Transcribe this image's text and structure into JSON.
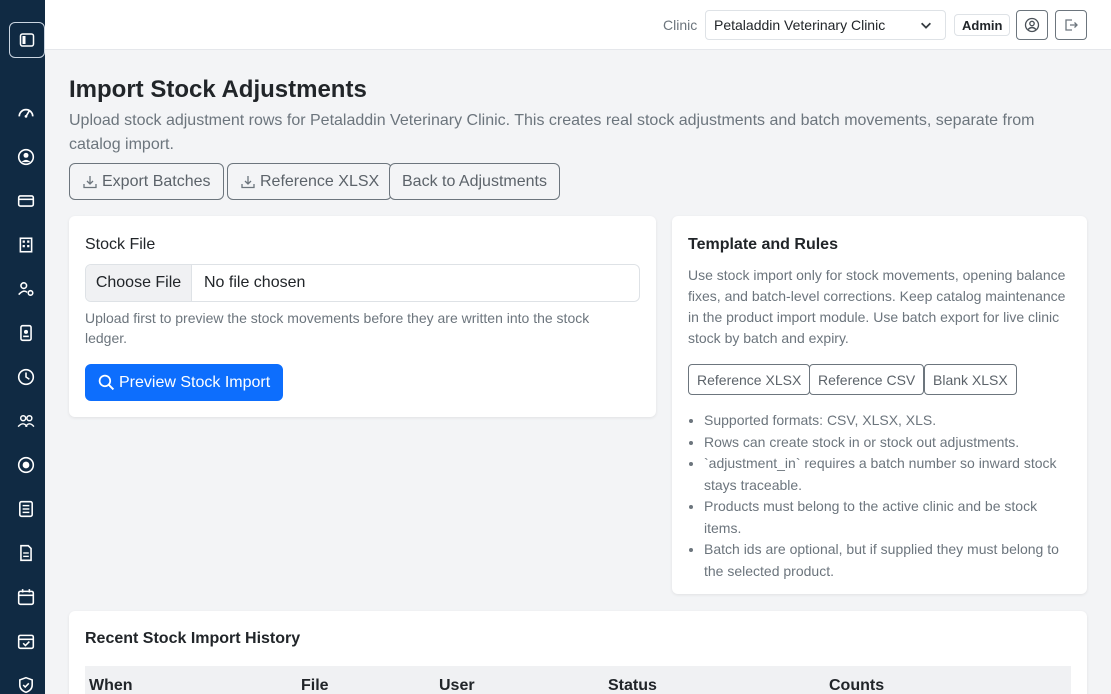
{
  "topbar": {
    "clinic_label": "Clinic",
    "clinic_selected": "Petaladdin Veterinary Clinic",
    "role_badge": "Admin"
  },
  "sidebar": {
    "icons": [
      "speedometer-icon",
      "user-circle-icon",
      "credit-card-icon",
      "building-icon",
      "user-gear-icon",
      "id-badge-icon",
      "clock-icon",
      "people-icon",
      "record-icon",
      "list-card-icon",
      "document-icon",
      "calendar-icon",
      "calendar-check-icon",
      "shield-icon"
    ]
  },
  "page": {
    "title": "Import Stock Adjustments",
    "description": "Upload stock adjustment rows for Petaladdin Veterinary Clinic. This creates real stock adjustments and batch movements, separate from catalog import."
  },
  "actions": {
    "export_batches": "Export Batches",
    "reference_xlsx": "Reference XLSX",
    "back": "Back to Adjustments"
  },
  "upload": {
    "label": "Stock File",
    "choose": "Choose File",
    "status": "No file chosen",
    "help": "Upload first to preview the stock movements before they are written into the stock ledger.",
    "preview_button": "Preview Stock Import"
  },
  "rules": {
    "title": "Template and Rules",
    "description": "Use stock import only for stock movements, opening balance fixes, and batch-level corrections. Keep catalog maintenance in the product import module. Use batch export for live clinic stock by batch and expiry.",
    "buttons": [
      "Reference XLSX",
      "Reference CSV",
      "Blank XLSX"
    ],
    "items": [
      "Supported formats: CSV, XLSX, XLS.",
      "Rows can create stock in or stock out adjustments.",
      "`adjustment_in` requires a batch number so inward stock stays traceable.",
      "Products must belong to the active clinic and be stock items.",
      "Batch ids are optional, but if supplied they must belong to the selected product."
    ]
  },
  "history": {
    "title": "Recent Stock Import History",
    "columns": [
      "When",
      "File",
      "User",
      "Status",
      "Counts"
    ]
  },
  "colors": {
    "sidebar": "#102a43",
    "primary": "#0d6efd",
    "background": "#f3f4f6"
  }
}
